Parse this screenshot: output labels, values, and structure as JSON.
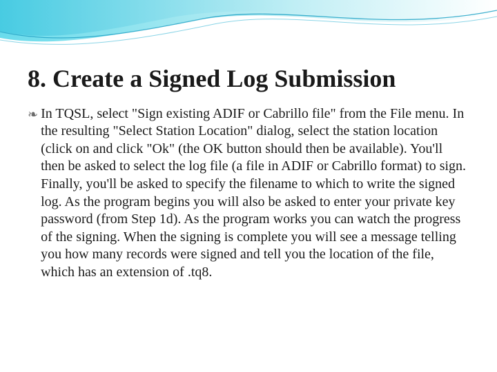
{
  "slide": {
    "title": "8. Create a Signed Log Submission",
    "bullet_glyph": "❧",
    "body": "In TQSL, select \"Sign existing ADIF or Cabrillo file\" from the File menu. In the resulting \"Select Station Location\" dialog, select the station location (click on and click \"Ok\" (the OK button should then be available). You'll then be asked to select the log file (a file in ADIF or Cabrillo format) to sign. Finally, you'll be asked to specify the filename to which to write the signed log. As the program begins you will also be asked to enter your private key password (from Step 1d). As the program works you can watch the progress of the signing. When the signing is complete you will see a message telling you how many records were signed and tell you the location of the file, which has an extension of .tq8."
  }
}
